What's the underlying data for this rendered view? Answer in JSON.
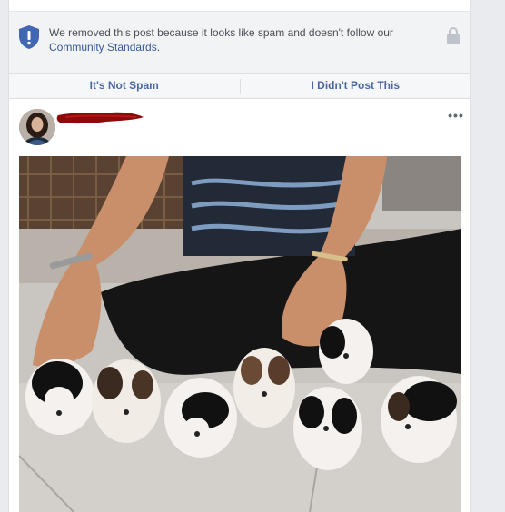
{
  "notice": {
    "message": "We removed this post because it looks like spam and doesn't follow our ",
    "link_text": "Community Standards",
    "suffix": "."
  },
  "actions": {
    "not_spam_label": "It's Not Spam",
    "didnt_post_label": "I Didn't Post This"
  },
  "post": {
    "more_label": "•••"
  },
  "colors": {
    "link": "#365899",
    "action_text": "#4b67a1",
    "shield": "#4267b2",
    "redaction": "#8b0a0a"
  }
}
